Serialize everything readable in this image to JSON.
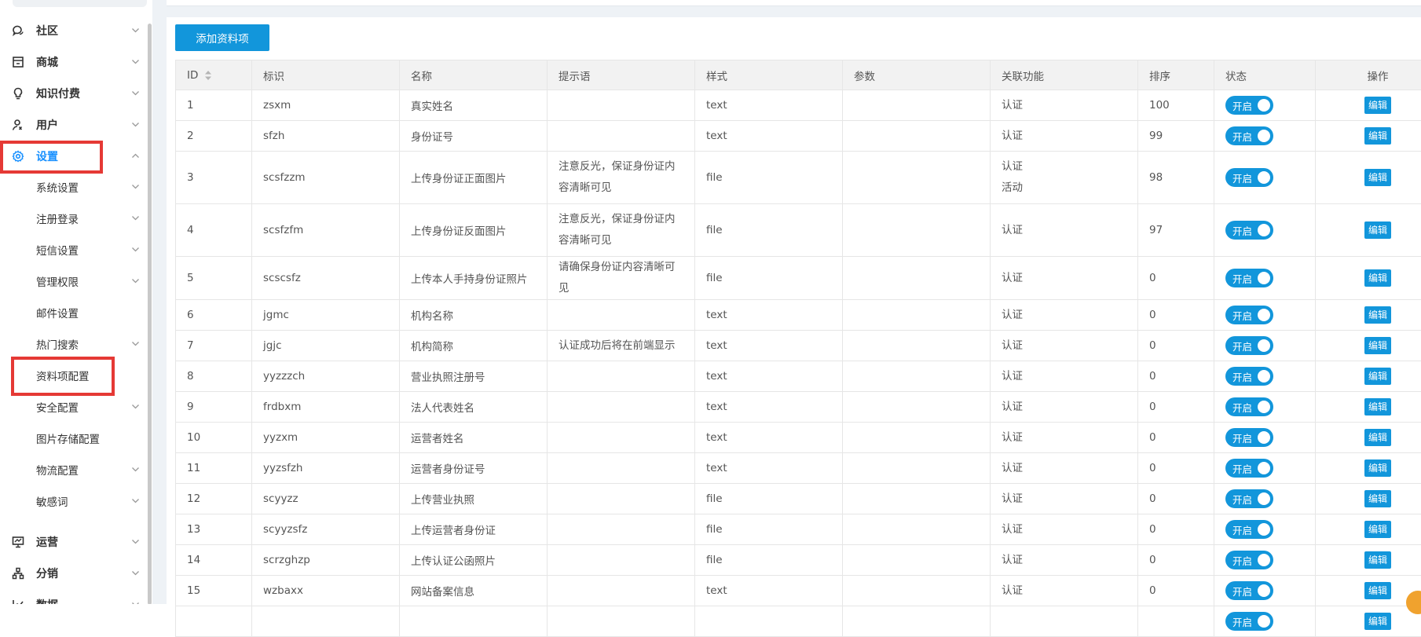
{
  "sidebar": {
    "top_menu": [
      {
        "label": "社区",
        "icon": "chat-icon"
      },
      {
        "label": "商城",
        "icon": "store-icon"
      },
      {
        "label": "知识付费",
        "icon": "bulb-icon"
      },
      {
        "label": "用户",
        "icon": "user-icon"
      },
      {
        "label": "设置",
        "icon": "gear-icon"
      }
    ],
    "settings_sub": [
      {
        "label": "系统设置",
        "chevron": true
      },
      {
        "label": "注册登录",
        "chevron": true
      },
      {
        "label": "短信设置",
        "chevron": true
      },
      {
        "label": "管理权限",
        "chevron": true
      },
      {
        "label": "邮件设置",
        "chevron": false
      },
      {
        "label": "热门搜索",
        "chevron": true
      },
      {
        "label": "资料项配置",
        "chevron": false
      },
      {
        "label": "安全配置",
        "chevron": true
      },
      {
        "label": "图片存储配置",
        "chevron": false
      },
      {
        "label": "物流配置",
        "chevron": true
      },
      {
        "label": "敏感词",
        "chevron": true
      }
    ],
    "bottom_menu": [
      {
        "label": "运营",
        "icon": "presentation-icon"
      },
      {
        "label": "分销",
        "icon": "hierarchy-icon"
      },
      {
        "label": "数据",
        "icon": "chart-icon"
      }
    ],
    "highlight_color": "#e53935",
    "accent_color": "#1890ff"
  },
  "toolbar": {
    "add_label": "添加资料项"
  },
  "table": {
    "headers": {
      "id": "ID",
      "key": "标识",
      "name": "名称",
      "hint": "提示语",
      "style": "样式",
      "params": "参数",
      "feature": "关联功能",
      "sort": "排序",
      "status": "状态",
      "ops": "操作"
    },
    "toggle_label": "开启",
    "edit_label": "编辑",
    "rows": [
      {
        "id": "1",
        "key": "zsxm",
        "name": "真实姓名",
        "hint": "",
        "style": "text",
        "params": "",
        "feature": "认证",
        "feature2": "",
        "sort": "100"
      },
      {
        "id": "2",
        "key": "sfzh",
        "name": "身份证号",
        "hint": "",
        "style": "text",
        "params": "",
        "feature": "认证",
        "feature2": "",
        "sort": "99"
      },
      {
        "id": "3",
        "key": "scsfzzm",
        "name": "上传身份证正面图片",
        "hint": "注意反光，保证身份证内容清晰可见",
        "style": "file",
        "params": "",
        "feature": "认证",
        "feature2": "活动",
        "sort": "98"
      },
      {
        "id": "4",
        "key": "scsfzfm",
        "name": "上传身份证反面图片",
        "hint": "注意反光，保证身份证内容清晰可见",
        "style": "file",
        "params": "",
        "feature": "认证",
        "feature2": "",
        "sort": "97"
      },
      {
        "id": "5",
        "key": "scscsfz",
        "name": "上传本人手持身份证照片",
        "hint": "请确保身份证内容清晰可见",
        "style": "file",
        "params": "",
        "feature": "认证",
        "feature2": "",
        "sort": "0"
      },
      {
        "id": "6",
        "key": "jgmc",
        "name": "机构名称",
        "hint": "",
        "style": "text",
        "params": "",
        "feature": "认证",
        "feature2": "",
        "sort": "0"
      },
      {
        "id": "7",
        "key": "jgjc",
        "name": "机构简称",
        "hint": "认证成功后将在前端显示",
        "style": "text",
        "params": "",
        "feature": "认证",
        "feature2": "",
        "sort": "0"
      },
      {
        "id": "8",
        "key": "yyzzzch",
        "name": "营业执照注册号",
        "hint": "",
        "style": "text",
        "params": "",
        "feature": "认证",
        "feature2": "",
        "sort": "0"
      },
      {
        "id": "9",
        "key": "frdbxm",
        "name": "法人代表姓名",
        "hint": "",
        "style": "text",
        "params": "",
        "feature": "认证",
        "feature2": "",
        "sort": "0"
      },
      {
        "id": "10",
        "key": "yyzxm",
        "name": "运营者姓名",
        "hint": "",
        "style": "text",
        "params": "",
        "feature": "认证",
        "feature2": "",
        "sort": "0"
      },
      {
        "id": "11",
        "key": "yyzsfzh",
        "name": "运营者身份证号",
        "hint": "",
        "style": "text",
        "params": "",
        "feature": "认证",
        "feature2": "",
        "sort": "0"
      },
      {
        "id": "12",
        "key": "scyyzz",
        "name": "上传营业执照",
        "hint": "",
        "style": "file",
        "params": "",
        "feature": "认证",
        "feature2": "",
        "sort": "0"
      },
      {
        "id": "13",
        "key": "scyyzsfz",
        "name": "上传运营者身份证",
        "hint": "",
        "style": "file",
        "params": "",
        "feature": "认证",
        "feature2": "",
        "sort": "0"
      },
      {
        "id": "14",
        "key": "scrzghzp",
        "name": "上传认证公函照片",
        "hint": "",
        "style": "file",
        "params": "",
        "feature": "认证",
        "feature2": "",
        "sort": "0"
      },
      {
        "id": "15",
        "key": "wzbaxx",
        "name": "网站备案信息",
        "hint": "",
        "style": "text",
        "params": "",
        "feature": "认证",
        "feature2": "",
        "sort": "0"
      },
      {
        "id": "",
        "key": "",
        "name": "",
        "hint": "",
        "style": "",
        "params": "",
        "feature": "",
        "feature2": "",
        "sort": ""
      }
    ],
    "primary_color": "#1296db"
  }
}
